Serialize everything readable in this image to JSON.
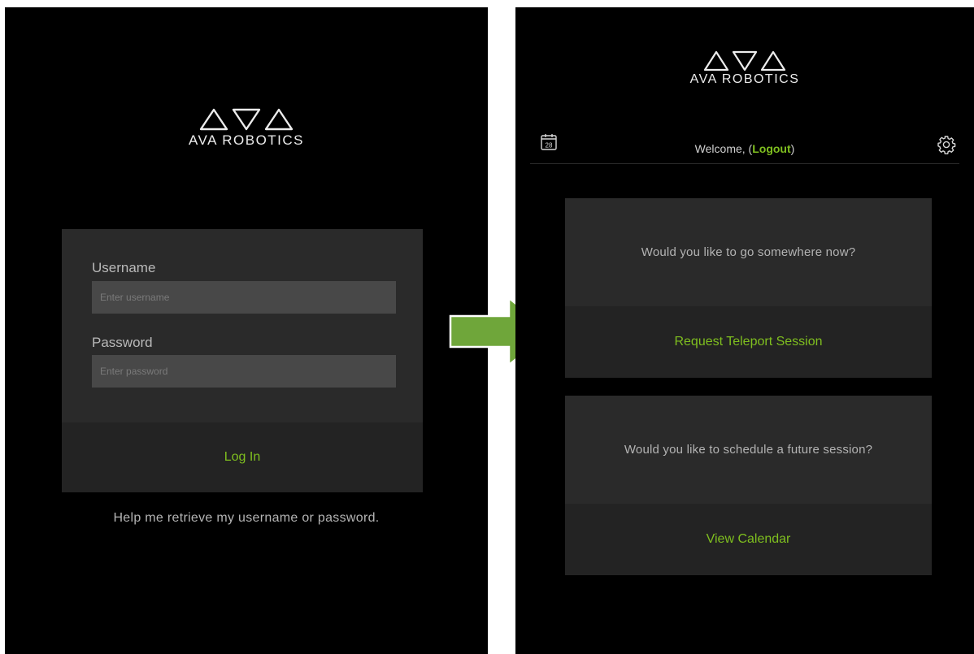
{
  "brand": {
    "name": "AVA ROBOTICS"
  },
  "login_screen": {
    "username_label": "Username",
    "username_placeholder": "Enter username",
    "password_label": "Password",
    "password_placeholder": "Enter password",
    "login_button": "Log In",
    "help_link": "Help me retrieve my username or password."
  },
  "transition": {
    "icon": "arrow-right-icon",
    "color": "#6fa63a"
  },
  "home_screen": {
    "calendar_day": "28",
    "welcome_text": "Welcome, (",
    "logout_link": "Logout",
    "welcome_close": ")",
    "cards": [
      {
        "question": "Would you like to go somewhere now?",
        "action": "Request Teleport Session"
      },
      {
        "question": "Would you like to schedule a future session?",
        "action": "View Calendar"
      }
    ]
  },
  "colors": {
    "background": "#000000",
    "accent": "#7fbf1f",
    "panel": "#2a2a2a"
  }
}
